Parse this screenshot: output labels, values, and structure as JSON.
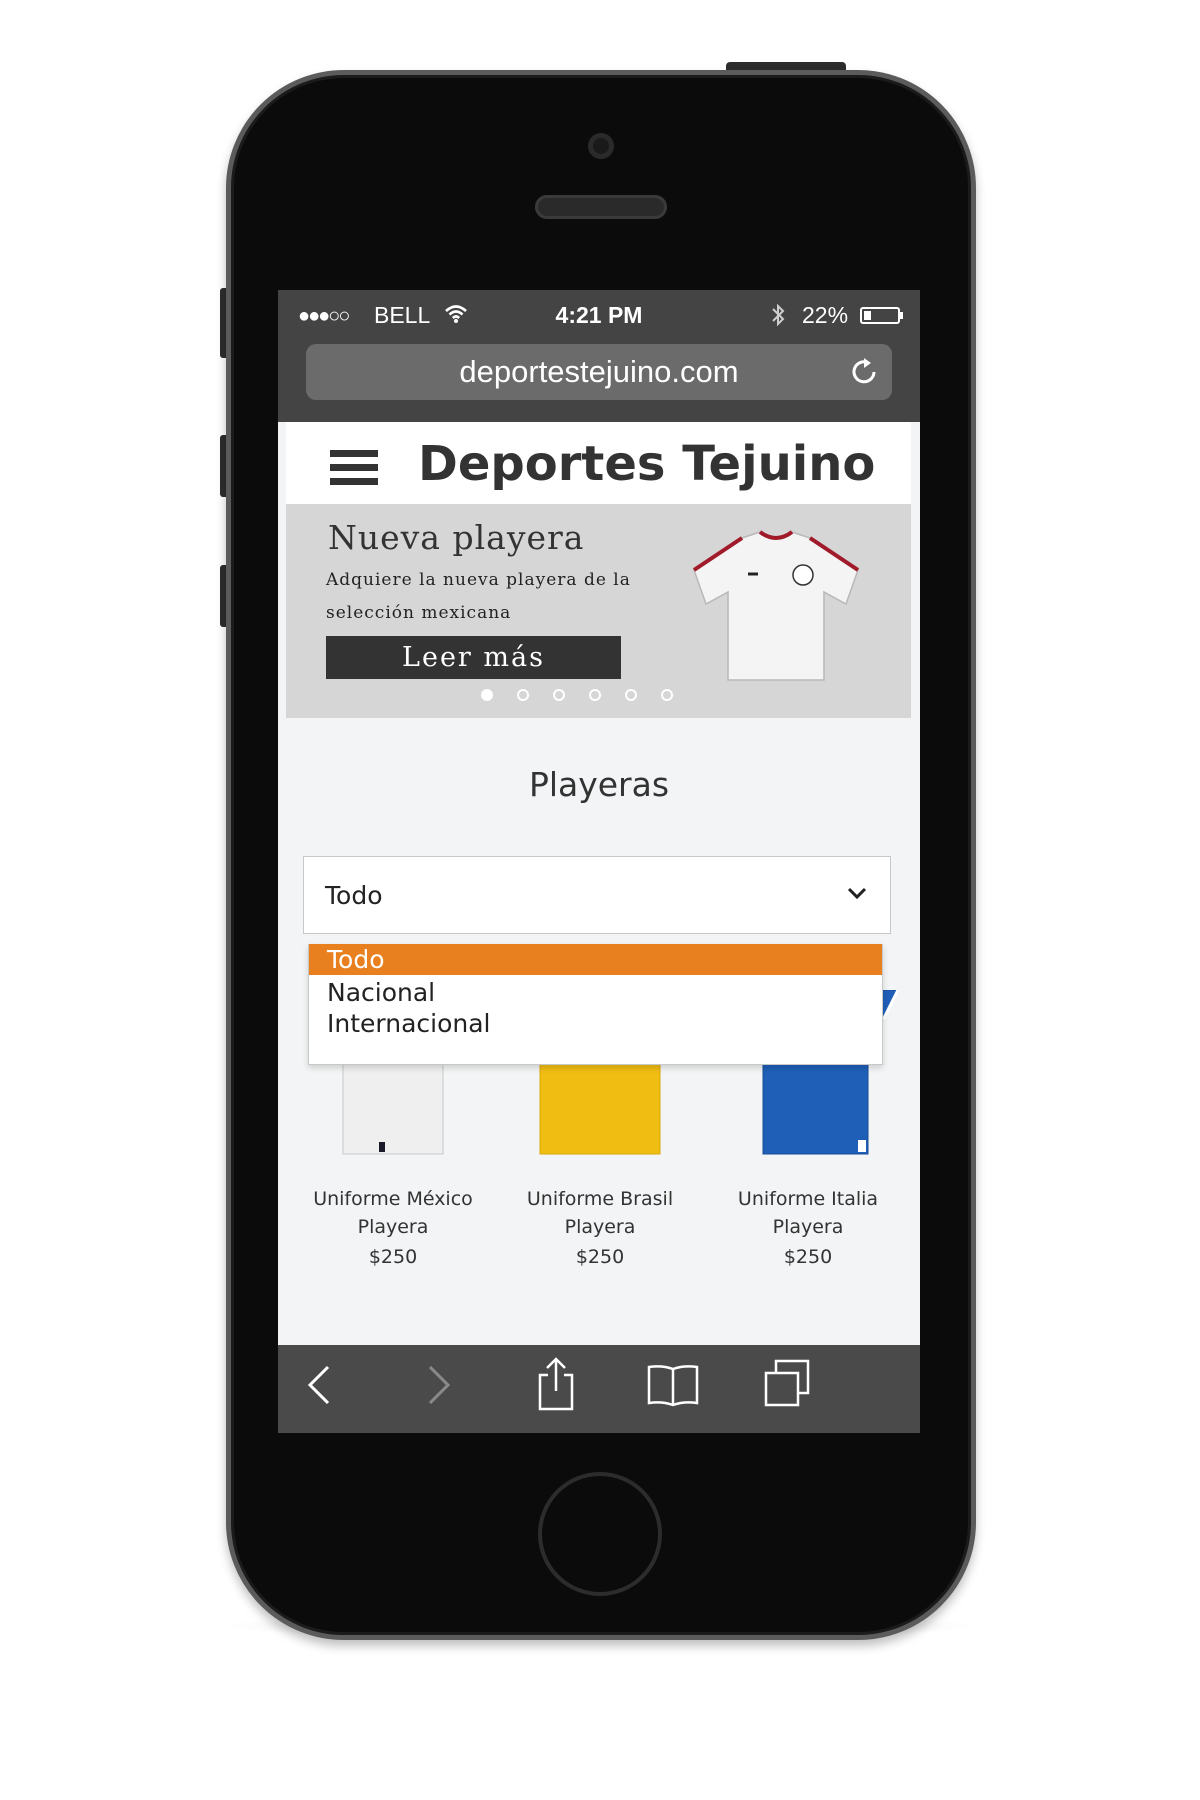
{
  "status_bar": {
    "signal": "●●●○○",
    "carrier": "BELL",
    "time": "4:21 PM",
    "battery": "22%",
    "battery_level": 0.22
  },
  "browser": {
    "url": "deportestejuino.com"
  },
  "site": {
    "title": "Deportes Tejuino"
  },
  "banner": {
    "title": "Nueva playera",
    "text": "Adquiere la nueva  playera de la selección mexicana",
    "cta": "Leer más",
    "slides": 6,
    "active_slide": 1
  },
  "section": {
    "title": "Playeras"
  },
  "filter": {
    "selected": "Todo",
    "options": [
      "Todo",
      "Nacional",
      "Internacional"
    ]
  },
  "products": [
    {
      "name": "Uniforme México",
      "type": "Playera",
      "price": "$250",
      "color": "#f1f1f1"
    },
    {
      "name": "Uniforme Brasil",
      "type": "Playera",
      "price": "$250",
      "color": "#f1c012"
    },
    {
      "name": "Uniforme Italia",
      "type": "Playera",
      "price": "$250",
      "color": "#1f5fb8"
    }
  ],
  "colors": {
    "accent": "#e8801f",
    "header_text": "#333333",
    "browser_chrome": "#444444"
  }
}
